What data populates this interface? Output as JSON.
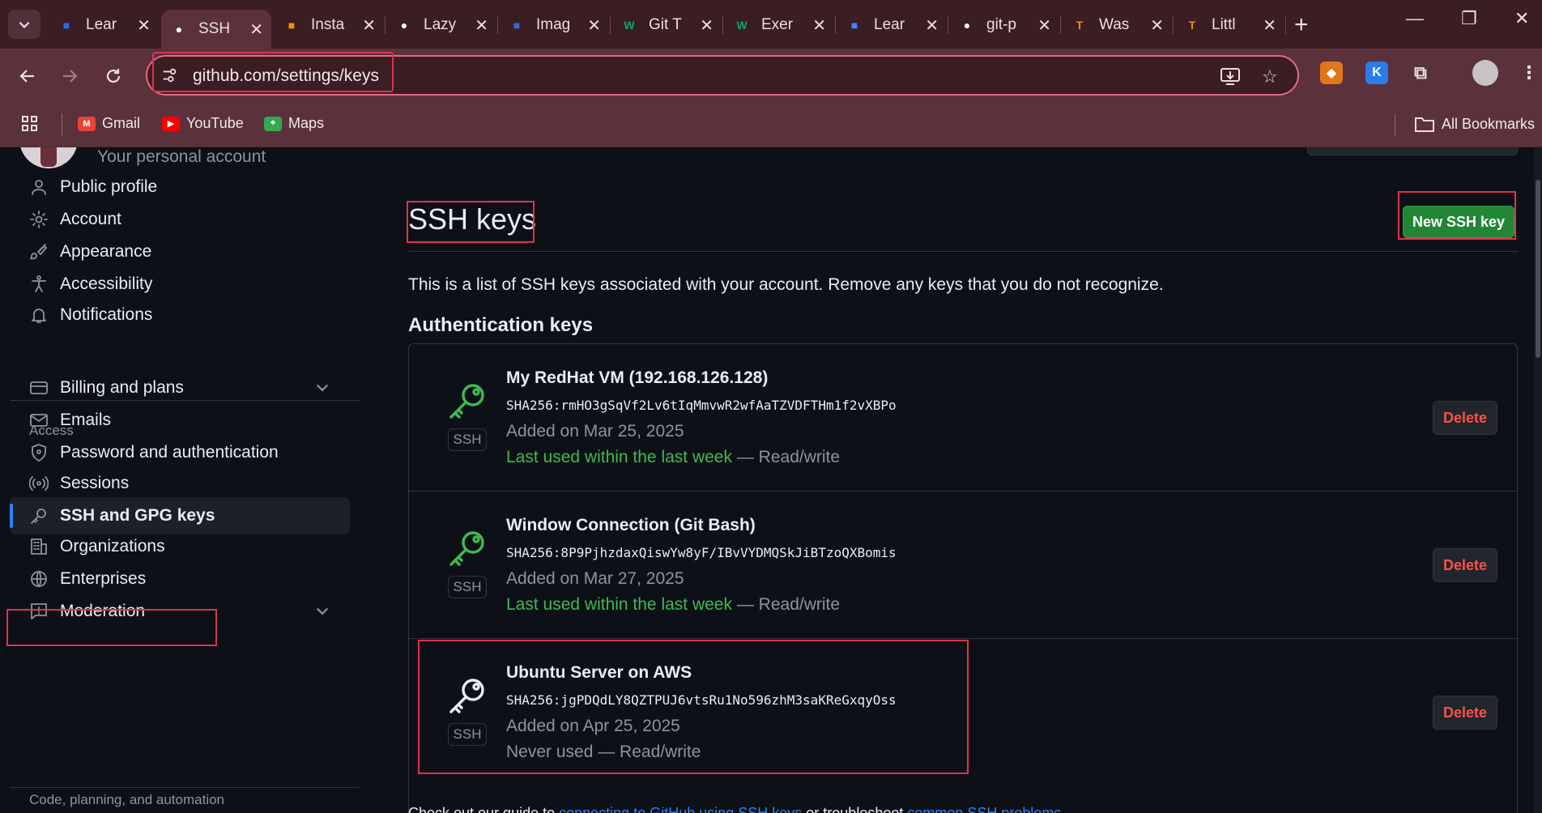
{
  "browser": {
    "tabs": [
      {
        "label": "Lear",
        "icon": "learn-favicon-icon",
        "color": "#2b6fe6"
      },
      {
        "label": "SSH",
        "icon": "github-favicon-icon",
        "color": "#ffffff",
        "active": true
      },
      {
        "label": "Insta",
        "icon": "instance-favicon-icon",
        "color": "#f29100"
      },
      {
        "label": "Lazy",
        "icon": "github-favicon-icon",
        "color": "#ffffff"
      },
      {
        "label": "Imag",
        "icon": "docs-favicon-icon",
        "color": "#3367d6"
      },
      {
        "label": "Git T",
        "icon": "w3schools-favicon-icon",
        "color": "#04aa6d"
      },
      {
        "label": "Exer",
        "icon": "w3schools-favicon-icon",
        "color": "#04aa6d"
      },
      {
        "label": "Lear",
        "icon": "learn-favicon-icon",
        "color": "#4285f4"
      },
      {
        "label": "git-p",
        "icon": "github-favicon-icon",
        "color": "#ffffff"
      },
      {
        "label": "Was",
        "icon": "t-favicon-icon",
        "color": "#f08a24"
      },
      {
        "label": "Littl",
        "icon": "t-favicon-icon",
        "color": "#f08a24"
      }
    ],
    "url": "github.com/settings/keys",
    "bookmarks": [
      {
        "label": "Gmail",
        "color": "#ea4335"
      },
      {
        "label": "YouTube",
        "color": "#ff0000"
      },
      {
        "label": "Maps",
        "color": "#34a853"
      }
    ],
    "all_bookmarks": "All Bookmarks"
  },
  "account": {
    "subtitle": "Your personal account"
  },
  "sidebar": {
    "items_top": [
      {
        "label": "Public profile",
        "icon": "person-icon"
      },
      {
        "label": "Account",
        "icon": "gear-icon"
      },
      {
        "label": "Appearance",
        "icon": "paintbrush-icon"
      },
      {
        "label": "Accessibility",
        "icon": "accessibility-icon"
      },
      {
        "label": "Notifications",
        "icon": "bell-icon"
      }
    ],
    "access_heading": "Access",
    "items_access": [
      {
        "label": "Billing and plans",
        "icon": "credit-card-icon",
        "expandable": true
      },
      {
        "label": "Emails",
        "icon": "mail-icon"
      },
      {
        "label": "Password and authentication",
        "icon": "shield-icon"
      },
      {
        "label": "Sessions",
        "icon": "broadcast-icon"
      },
      {
        "label": "SSH and GPG keys",
        "icon": "key-icon",
        "selected": true
      },
      {
        "label": "Organizations",
        "icon": "organization-icon"
      },
      {
        "label": "Enterprises",
        "icon": "globe-icon"
      },
      {
        "label": "Moderation",
        "icon": "report-icon",
        "expandable": true
      }
    ],
    "code_heading": "Code, planning, and automation"
  },
  "main": {
    "title": "SSH keys",
    "new_key_button": "New SSH key",
    "intro": "This is a list of SSH keys associated with your account. Remove any keys that you do not recognize.",
    "auth_heading": "Authentication keys",
    "keys": [
      {
        "name": "My RedHat VM (192.168.126.128)",
        "fingerprint": "SHA256:rmHO3gSqVf2Lv6tIqMmvwR2wfAaTZVDFTHm1f2vXBPo",
        "added": "Added on Mar 25, 2025",
        "last_used": "Last used within the last week",
        "access": " — Read/write",
        "type": "SSH",
        "recent": true,
        "delete": "Delete"
      },
      {
        "name": "Window Connection (Git Bash)",
        "fingerprint": "SHA256:8P9PjhzdaxQiswYw8yF/IBvVYDMQSkJiBTzoQXBomis",
        "added": "Added on Mar 27, 2025",
        "last_used": "Last used within the last week",
        "access": " — Read/write",
        "type": "SSH",
        "recent": true,
        "delete": "Delete"
      },
      {
        "name": "Ubuntu Server on AWS",
        "fingerprint": "SHA256:jgPDQdLY8QZTPUJ6vtsRu1No596zhM3saKReGxqyOss",
        "added": "Added on Apr 25, 2025",
        "last_used": "Never used",
        "access": " — Read/write",
        "type": "SSH",
        "recent": false,
        "delete": "Delete"
      }
    ],
    "footer_start": "Check out our guide to ",
    "footer_link1": "connecting to GitHub using SSH keys",
    "footer_mid": " or troubleshoot ",
    "footer_link2": "common SSH problems",
    "footer_end": "."
  }
}
